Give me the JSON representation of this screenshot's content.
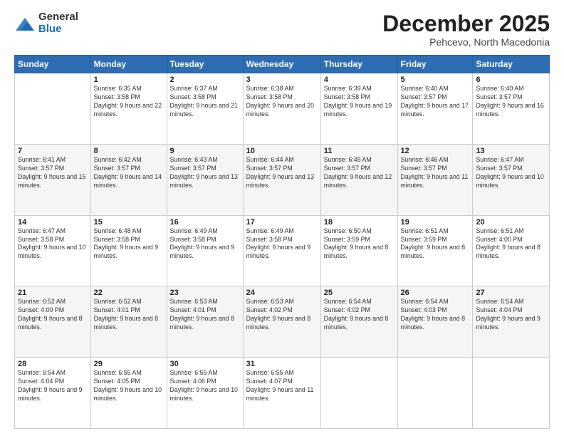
{
  "logo": {
    "general": "General",
    "blue": "Blue"
  },
  "header": {
    "month": "December 2025",
    "location": "Pehcevo, North Macedonia"
  },
  "weekdays": [
    "Sunday",
    "Monday",
    "Tuesday",
    "Wednesday",
    "Thursday",
    "Friday",
    "Saturday"
  ],
  "weeks": [
    [
      {
        "day": "",
        "sunrise": "",
        "sunset": "",
        "daylight": ""
      },
      {
        "day": "1",
        "sunrise": "Sunrise: 6:35 AM",
        "sunset": "Sunset: 3:58 PM",
        "daylight": "Daylight: 9 hours and 22 minutes."
      },
      {
        "day": "2",
        "sunrise": "Sunrise: 6:37 AM",
        "sunset": "Sunset: 3:58 PM",
        "daylight": "Daylight: 9 hours and 21 minutes."
      },
      {
        "day": "3",
        "sunrise": "Sunrise: 6:38 AM",
        "sunset": "Sunset: 3:58 PM",
        "daylight": "Daylight: 9 hours and 20 minutes."
      },
      {
        "day": "4",
        "sunrise": "Sunrise: 6:39 AM",
        "sunset": "Sunset: 3:58 PM",
        "daylight": "Daylight: 9 hours and 19 minutes."
      },
      {
        "day": "5",
        "sunrise": "Sunrise: 6:40 AM",
        "sunset": "Sunset: 3:57 PM",
        "daylight": "Daylight: 9 hours and 17 minutes."
      },
      {
        "day": "6",
        "sunrise": "Sunrise: 6:40 AM",
        "sunset": "Sunset: 3:57 PM",
        "daylight": "Daylight: 9 hours and 16 minutes."
      }
    ],
    [
      {
        "day": "7",
        "sunrise": "Sunrise: 6:41 AM",
        "sunset": "Sunset: 3:57 PM",
        "daylight": "Daylight: 9 hours and 15 minutes."
      },
      {
        "day": "8",
        "sunrise": "Sunrise: 6:42 AM",
        "sunset": "Sunset: 3:57 PM",
        "daylight": "Daylight: 9 hours and 14 minutes."
      },
      {
        "day": "9",
        "sunrise": "Sunrise: 6:43 AM",
        "sunset": "Sunset: 3:57 PM",
        "daylight": "Daylight: 9 hours and 13 minutes."
      },
      {
        "day": "10",
        "sunrise": "Sunrise: 6:44 AM",
        "sunset": "Sunset: 3:57 PM",
        "daylight": "Daylight: 9 hours and 13 minutes."
      },
      {
        "day": "11",
        "sunrise": "Sunrise: 6:45 AM",
        "sunset": "Sunset: 3:57 PM",
        "daylight": "Daylight: 9 hours and 12 minutes."
      },
      {
        "day": "12",
        "sunrise": "Sunrise: 6:46 AM",
        "sunset": "Sunset: 3:57 PM",
        "daylight": "Daylight: 9 hours and 11 minutes."
      },
      {
        "day": "13",
        "sunrise": "Sunrise: 6:47 AM",
        "sunset": "Sunset: 3:57 PM",
        "daylight": "Daylight: 9 hours and 10 minutes."
      }
    ],
    [
      {
        "day": "14",
        "sunrise": "Sunrise: 6:47 AM",
        "sunset": "Sunset: 3:58 PM",
        "daylight": "Daylight: 9 hours and 10 minutes."
      },
      {
        "day": "15",
        "sunrise": "Sunrise: 6:48 AM",
        "sunset": "Sunset: 3:58 PM",
        "daylight": "Daylight: 9 hours and 9 minutes."
      },
      {
        "day": "16",
        "sunrise": "Sunrise: 6:49 AM",
        "sunset": "Sunset: 3:58 PM",
        "daylight": "Daylight: 9 hours and 9 minutes."
      },
      {
        "day": "17",
        "sunrise": "Sunrise: 6:49 AM",
        "sunset": "Sunset: 3:58 PM",
        "daylight": "Daylight: 9 hours and 9 minutes."
      },
      {
        "day": "18",
        "sunrise": "Sunrise: 6:50 AM",
        "sunset": "Sunset: 3:59 PM",
        "daylight": "Daylight: 9 hours and 8 minutes."
      },
      {
        "day": "19",
        "sunrise": "Sunrise: 6:51 AM",
        "sunset": "Sunset: 3:59 PM",
        "daylight": "Daylight: 9 hours and 8 minutes."
      },
      {
        "day": "20",
        "sunrise": "Sunrise: 6:51 AM",
        "sunset": "Sunset: 4:00 PM",
        "daylight": "Daylight: 9 hours and 8 minutes."
      }
    ],
    [
      {
        "day": "21",
        "sunrise": "Sunrise: 6:52 AM",
        "sunset": "Sunset: 4:00 PM",
        "daylight": "Daylight: 9 hours and 8 minutes."
      },
      {
        "day": "22",
        "sunrise": "Sunrise: 6:52 AM",
        "sunset": "Sunset: 4:01 PM",
        "daylight": "Daylight: 9 hours and 8 minutes."
      },
      {
        "day": "23",
        "sunrise": "Sunrise: 6:53 AM",
        "sunset": "Sunset: 4:01 PM",
        "daylight": "Daylight: 9 hours and 8 minutes."
      },
      {
        "day": "24",
        "sunrise": "Sunrise: 6:53 AM",
        "sunset": "Sunset: 4:02 PM",
        "daylight": "Daylight: 9 hours and 8 minutes."
      },
      {
        "day": "25",
        "sunrise": "Sunrise: 6:54 AM",
        "sunset": "Sunset: 4:02 PM",
        "daylight": "Daylight: 9 hours and 8 minutes."
      },
      {
        "day": "26",
        "sunrise": "Sunrise: 6:54 AM",
        "sunset": "Sunset: 4:03 PM",
        "daylight": "Daylight: 9 hours and 8 minutes."
      },
      {
        "day": "27",
        "sunrise": "Sunrise: 6:54 AM",
        "sunset": "Sunset: 4:04 PM",
        "daylight": "Daylight: 9 hours and 9 minutes."
      }
    ],
    [
      {
        "day": "28",
        "sunrise": "Sunrise: 6:54 AM",
        "sunset": "Sunset: 4:04 PM",
        "daylight": "Daylight: 9 hours and 9 minutes."
      },
      {
        "day": "29",
        "sunrise": "Sunrise: 6:55 AM",
        "sunset": "Sunset: 4:05 PM",
        "daylight": "Daylight: 9 hours and 10 minutes."
      },
      {
        "day": "30",
        "sunrise": "Sunrise: 6:55 AM",
        "sunset": "Sunset: 4:06 PM",
        "daylight": "Daylight: 9 hours and 10 minutes."
      },
      {
        "day": "31",
        "sunrise": "Sunrise: 6:55 AM",
        "sunset": "Sunset: 4:07 PM",
        "daylight": "Daylight: 9 hours and 11 minutes."
      },
      {
        "day": "",
        "sunrise": "",
        "sunset": "",
        "daylight": ""
      },
      {
        "day": "",
        "sunrise": "",
        "sunset": "",
        "daylight": ""
      },
      {
        "day": "",
        "sunrise": "",
        "sunset": "",
        "daylight": ""
      }
    ]
  ]
}
